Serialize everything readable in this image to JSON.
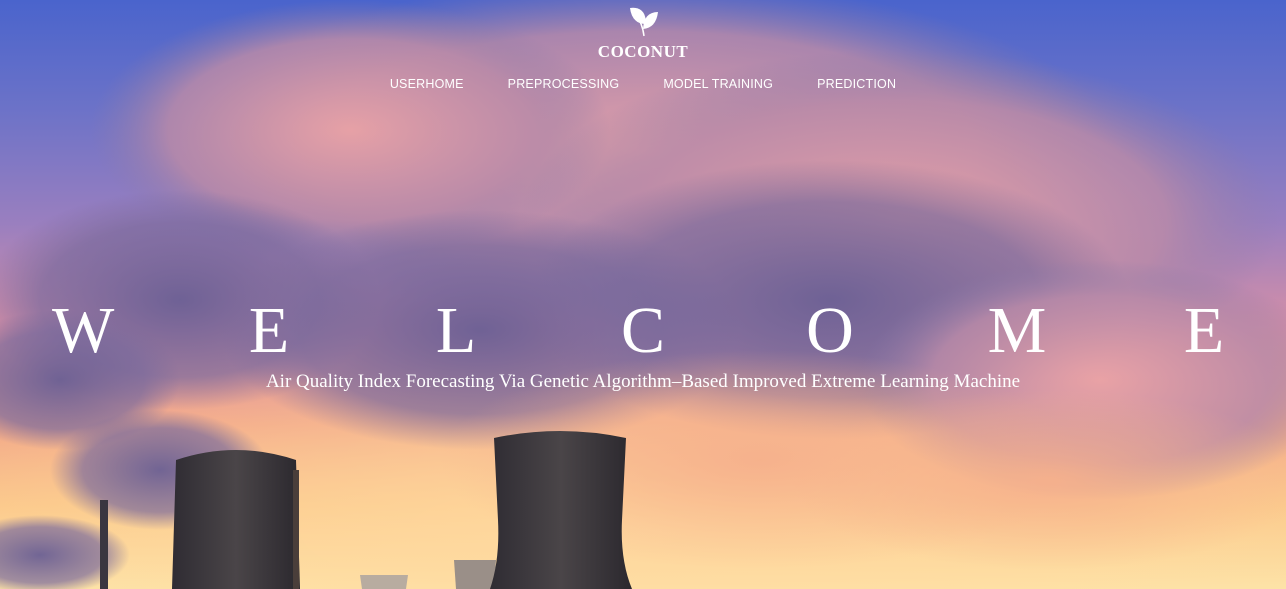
{
  "brand": {
    "name": "COCONUT",
    "logo": "leaf-icon"
  },
  "nav": {
    "items": [
      {
        "label": "USERHOME"
      },
      {
        "label": "PREPROCESSING"
      },
      {
        "label": "MODEL TRAINING"
      },
      {
        "label": "PREDICTION"
      }
    ]
  },
  "hero": {
    "letters": [
      "W",
      "E",
      "L",
      "C",
      "O",
      "M",
      "E"
    ],
    "subtitle": "Air Quality Index Forecasting Via Genetic Algorithm–Based Improved Extreme Learning Machine",
    "background": "sunset-smoke-cooling-towers-photo"
  },
  "colors": {
    "sky_top": "#4a64cc",
    "sky_bottom": "#fde4a8",
    "text": "#ffffff"
  }
}
